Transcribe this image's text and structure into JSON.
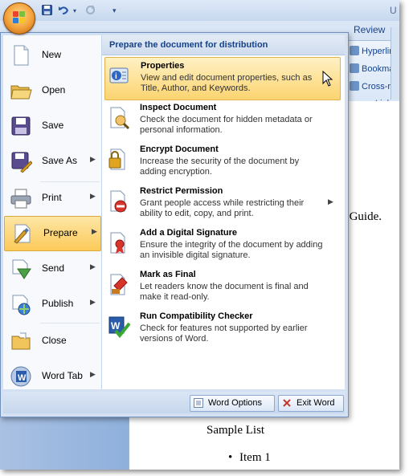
{
  "qat": {
    "save_icon": "save-icon",
    "undo_icon": "undo-icon",
    "redo_icon": "redo-icon",
    "customize_icon": "customize-icon"
  },
  "ribbon": {
    "title_fragment": "U",
    "review_tab": "Review",
    "links_group": {
      "label": "Links",
      "items": [
        "Hyperlin",
        "Bookma",
        "Cross-re"
      ]
    }
  },
  "document": {
    "line1": "s Guide.",
    "line2": "Sample List",
    "bullet": "•",
    "line3": "Item 1"
  },
  "menu": {
    "left_items": [
      {
        "label": "New",
        "icon": "new-document-icon"
      },
      {
        "label": "Open",
        "icon": "open-folder-icon"
      },
      {
        "label": "Save",
        "icon": "save-disk-icon"
      },
      {
        "label": "Save As",
        "icon": "save-as-icon",
        "submenu": true
      },
      {
        "label": "Print",
        "icon": "printer-icon",
        "submenu": true
      },
      {
        "label": "Prepare",
        "icon": "prepare-icon",
        "submenu": true,
        "active": true
      },
      {
        "label": "Send",
        "icon": "send-icon",
        "submenu": true
      },
      {
        "label": "Publish",
        "icon": "publish-icon",
        "submenu": true
      },
      {
        "label": "Close",
        "icon": "close-folder-icon"
      },
      {
        "label": "Word Tab",
        "icon": "word-tab-icon",
        "submenu": true
      }
    ],
    "submenu_header": "Prepare the document for distribution",
    "submenu_items": [
      {
        "title": "Properties",
        "desc": "View and edit document properties, such as Title, Author, and Keywords.",
        "icon": "properties-icon",
        "active": true
      },
      {
        "title": "Inspect Document",
        "desc": "Check the document for hidden metadata or personal information.",
        "icon": "inspect-document-icon"
      },
      {
        "title": "Encrypt Document",
        "desc": "Increase the security of the document by adding encryption.",
        "icon": "encrypt-lock-icon"
      },
      {
        "title": "Restrict Permission",
        "desc": "Grant people access while restricting their ability to edit, copy, and print.",
        "icon": "restrict-permission-icon",
        "submenu": true
      },
      {
        "title": "Add a Digital Signature",
        "desc": "Ensure the integrity of the document by adding an invisible digital signature.",
        "icon": "digital-signature-icon"
      },
      {
        "title": "Mark as Final",
        "desc": "Let readers know the document is final and make it read-only.",
        "icon": "mark-final-icon"
      },
      {
        "title": "Run Compatibility Checker",
        "desc": "Check for features not supported by earlier versions of Word.",
        "icon": "compatibility-checker-icon"
      }
    ],
    "footer": {
      "word_options": "Word Options",
      "exit_word": "Exit Word"
    }
  }
}
